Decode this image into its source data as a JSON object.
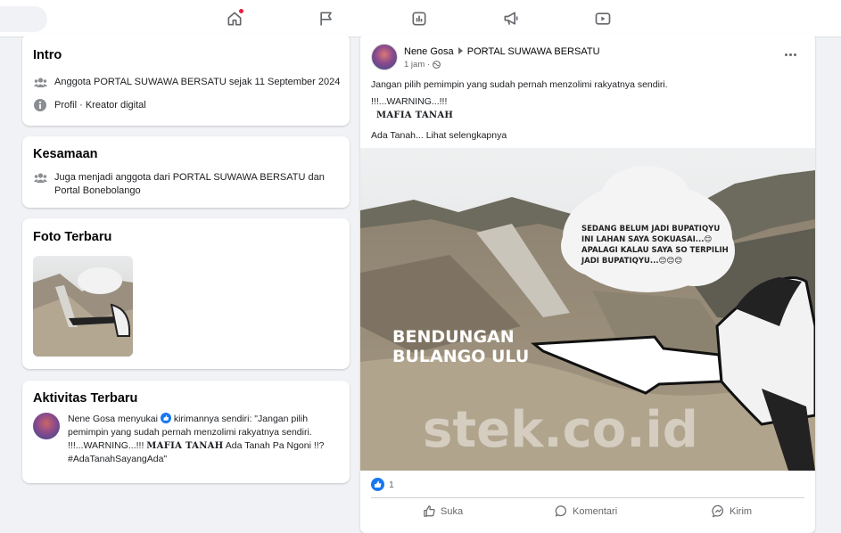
{
  "nav": {
    "icons": [
      "home-icon",
      "flag-icon",
      "dashboard-icon",
      "megaphone-icon",
      "video-icon"
    ]
  },
  "intro": {
    "title": "Intro",
    "member_line": "Anggota PORTAL SUWAWA BERSATU sejak 11 September 2024",
    "profile_line": "Profil · Kreator digital"
  },
  "kesamaan": {
    "title": "Kesamaan",
    "line": "Juga menjadi anggota dari PORTAL SUWAWA BERSATU dan Portal Bonebolango"
  },
  "foto": {
    "title": "Foto Terbaru"
  },
  "aktivitas": {
    "title": "Aktivitas Terbaru",
    "actor": "Nene Gosa",
    "verb": "menyukai",
    "rest": "kirimannya sendiri: \"Jangan pilih pemimpin yang sudah pernah menzolimi rakyatnya sendiri. !!!...WARNING...!!!",
    "bold": "MAFIA TANAH",
    "tail": "Ada Tanah Pa Ngoni !!? #AdaTanahSayangAda\""
  },
  "post": {
    "author": "Nene Gosa",
    "group": "PORTAL SUWAWA BERSATU",
    "time": "1 jam ·",
    "line1": "Jangan pilih pemimpin yang sudah pernah menzolimi rakyatnya sendiri.",
    "line2": "!!!...WARNING...!!!",
    "line3": "MAFIA TANAH",
    "line4": "Ada Tanah... Lihat selengkapnya",
    "image_caption": "BENDUNGAN BULANGO ULU",
    "image_caption_line1": "BENDUNGAN",
    "image_caption_line2": "BULANGO ULU",
    "bubble_line1": "SEDANG BELUM JADI BUPATIQYU",
    "bubble_line2": "INI LAHAN SAYA SOKUASAI...😊",
    "bubble_line3": "APALAGI KALAU SAYA SO TERPILIH",
    "bubble_line4": "JADI BUPATIQYU...😊😊😊",
    "watermark": "stek.co.id",
    "reaction_count": "1",
    "actions": {
      "like": "Suka",
      "comment": "Komentari",
      "send": "Kirim"
    }
  },
  "colors": {
    "accent": "#1877f2",
    "notif": "#e41e3f",
    "bg": "#f0f2f5"
  }
}
